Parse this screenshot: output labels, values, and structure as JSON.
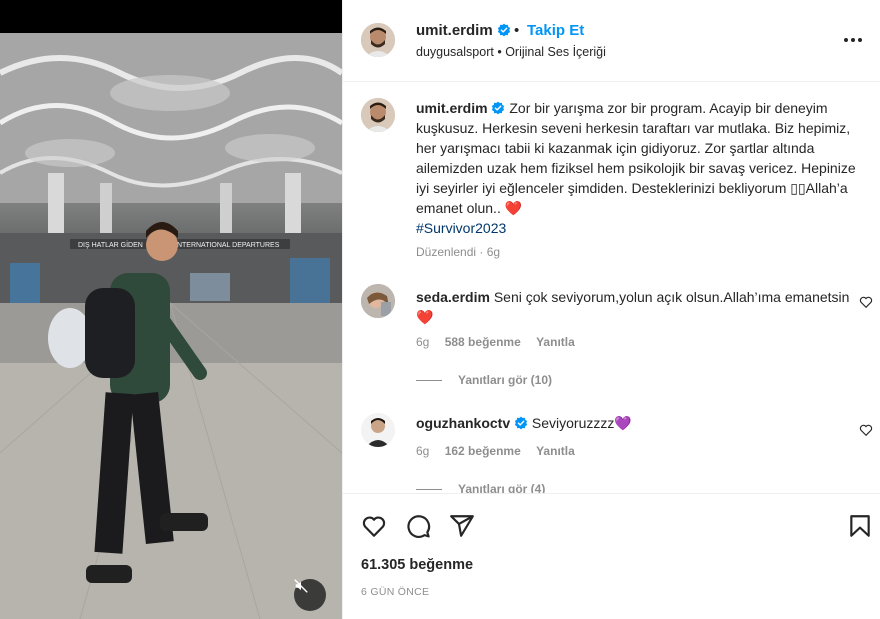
{
  "post": {
    "username": "umit.erdim",
    "follow_label": "Takip Et",
    "dot": "•",
    "audio_user": "duygusalsport",
    "audio_sep": "•",
    "audio_label": "Orijinal Ses İçeriği",
    "photo_signs": [
      "DIŞ HATLAR GİDEN",
      "INTERNATIONAL DEPARTURES"
    ]
  },
  "caption": {
    "username": "umit.erdim",
    "text_part1": "Zor bir yarışma zor bir program. Acayip bir deneyim kuşkusuz. Herkesin seveni herkesin taraftarı var mutlaka. Biz hepimiz, her yarışmacı tabii ki kazanmak için gidiyoruz. Zor şartlar altında ailemizden uzak hem fiziksel hem psikolojik bir savaş vericez. Hepinize iyi seyirler iyi eğlenceler şimdiden. Desteklerinizi bekliyorum ",
    "text_glyphs": "▯▯",
    "text_part2": "Allah’a emanet olun.. ",
    "heart": "❤️",
    "hashtag": "#Survivor2023",
    "edited_label": "Düzenlendi",
    "edited_sep": "·",
    "edited_time": "6g"
  },
  "comments": [
    {
      "username": "seda.erdim",
      "text": "Seni çok seviyorum,yolun açık olsun.Allah’ıma emanetsin",
      "emoji": "❤️",
      "time": "6g",
      "likes": "588 beğenme",
      "reply_label": "Yanıtla",
      "view_replies": "Yanıtları gör (10)"
    },
    {
      "username": "oguzhankoctv",
      "text": "Seviyoruzzzz",
      "emoji": "💜",
      "time": "6g",
      "likes": "162 beğenme",
      "reply_label": "Yanıtla",
      "view_replies": "Yanıtları gör (4)"
    }
  ],
  "actions": {
    "like_count": "61.305 beğenme",
    "time_ago": "6 GÜN ÖNCE"
  },
  "icons": {
    "verified": "verified-badge-icon",
    "more": "more-options-icon",
    "mute": "audio-muted-icon",
    "like": "heart-outline-icon",
    "comment": "comment-bubble-icon",
    "share": "paper-plane-icon",
    "save": "bookmark-icon"
  },
  "colors": {
    "accent": "#0095f6",
    "verified": "#0095f6",
    "text": "#262626",
    "muted": "#8e8e8e",
    "heart": "#ed4956",
    "purple_heart": "#9b59d0"
  }
}
